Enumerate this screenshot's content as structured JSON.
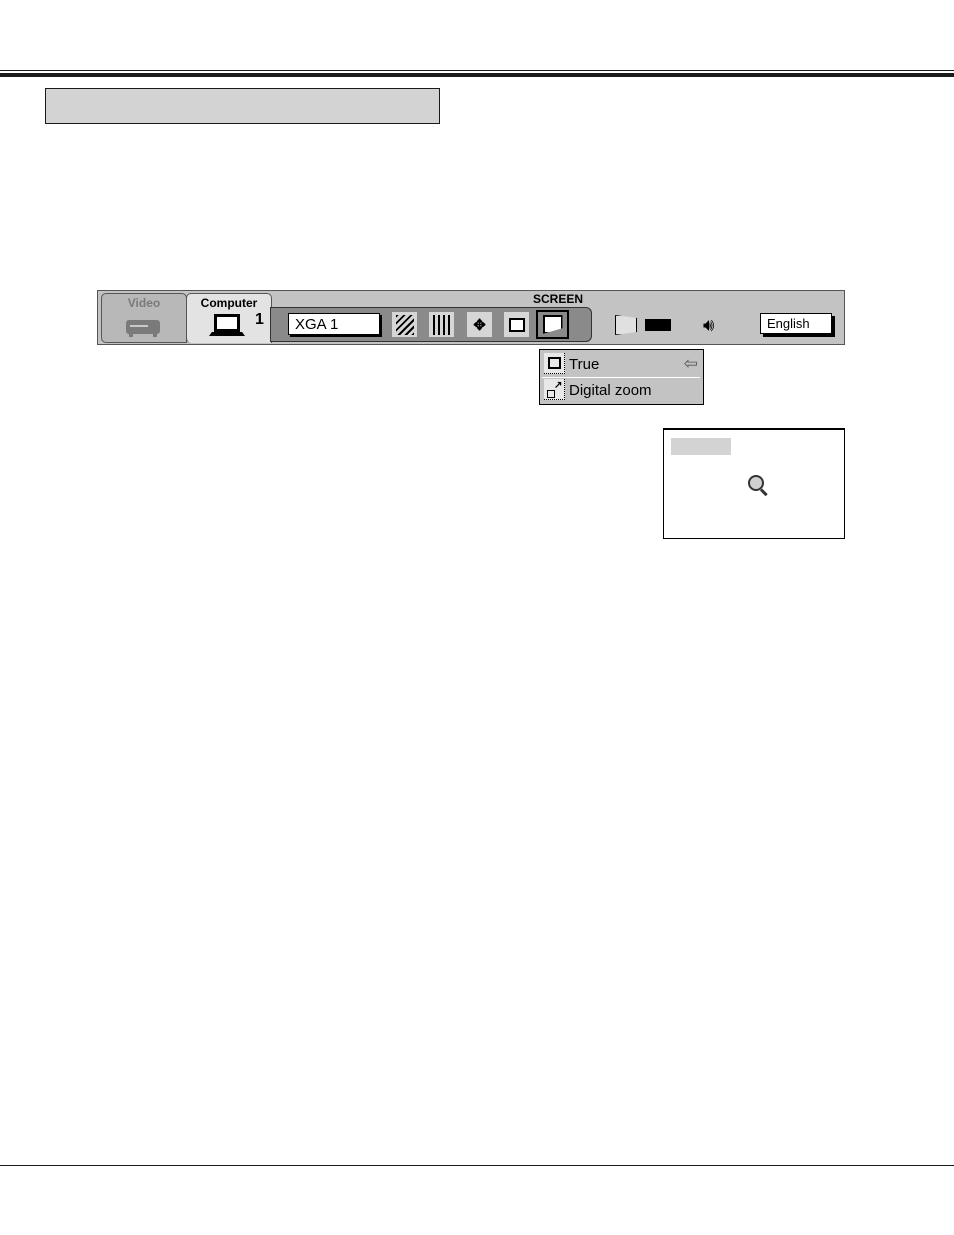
{
  "menu": {
    "tabs": [
      {
        "label": "Video",
        "icon": "vcr-icon",
        "active": false
      },
      {
        "label": "Computer",
        "icon": "laptop-icon",
        "active": true,
        "number": "1"
      }
    ],
    "screen_section_label": "SCREEN",
    "mode_value": "XGA 1",
    "icon_buttons": [
      "pc-adjust-sync-icon",
      "pc-adjust-tracking-icon",
      "position-icon",
      "pc-system-icon",
      "screen-icon"
    ],
    "selected_icon": "screen-icon",
    "image_icon": "projector-image-icon",
    "sound_icon": "speaker-icon",
    "language_label": "English"
  },
  "dropdown": {
    "items": [
      {
        "label": "True",
        "icon": "true-size-icon",
        "selected": true,
        "pointer": "⇦"
      },
      {
        "label": "Digital zoom",
        "icon": "digital-zoom-icon",
        "selected": false
      }
    ]
  },
  "preview": {
    "icon": "magnifier-icon"
  }
}
